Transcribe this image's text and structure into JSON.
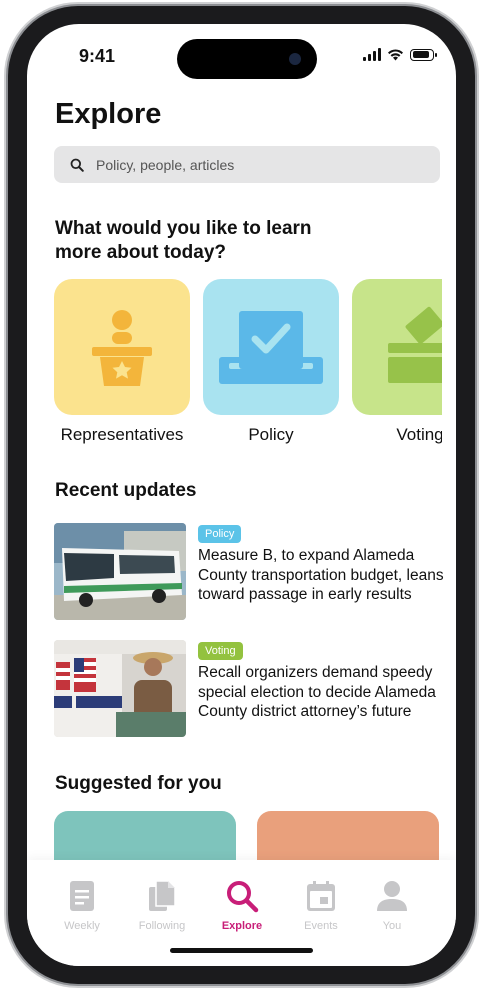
{
  "status_bar": {
    "time": "9:41"
  },
  "page": {
    "title": "Explore",
    "search_placeholder": "Policy, people, articles"
  },
  "learn": {
    "heading_line1": "What would you like to learn",
    "heading_line2": "more about today?",
    "categories": [
      {
        "label": "Representatives",
        "color": "#fbe38e",
        "icon": "podium-icon"
      },
      {
        "label": "Policy",
        "color": "#a9e3f0",
        "icon": "checkbox-ballot-icon"
      },
      {
        "label": "Voting",
        "color": "#c7e48a",
        "icon": "ballot-box-icon"
      }
    ]
  },
  "recent": {
    "heading": "Recent updates",
    "items": [
      {
        "tag": "Policy",
        "tag_color": "#5bc3e8",
        "headline": "Measure B, to expand Alameda County transportation budget, leans toward passage in early results"
      },
      {
        "tag": "Voting",
        "tag_color": "#93c23f",
        "headline": "Recall organizers demand speedy special election to decide Alameda County district attorney’s future"
      }
    ]
  },
  "suggested": {
    "heading": "Suggested for you",
    "card_colors": [
      "#7ec4bc",
      "#e9a07c"
    ]
  },
  "tabbar": {
    "accent": "#c81e78",
    "items": [
      {
        "label": "Weekly",
        "icon": "document-icon"
      },
      {
        "label": "Following",
        "icon": "copy-document-icon"
      },
      {
        "label": "Explore",
        "icon": "search-icon",
        "active": true
      },
      {
        "label": "Events",
        "icon": "calendar-icon"
      },
      {
        "label": "You",
        "icon": "person-icon"
      }
    ]
  }
}
